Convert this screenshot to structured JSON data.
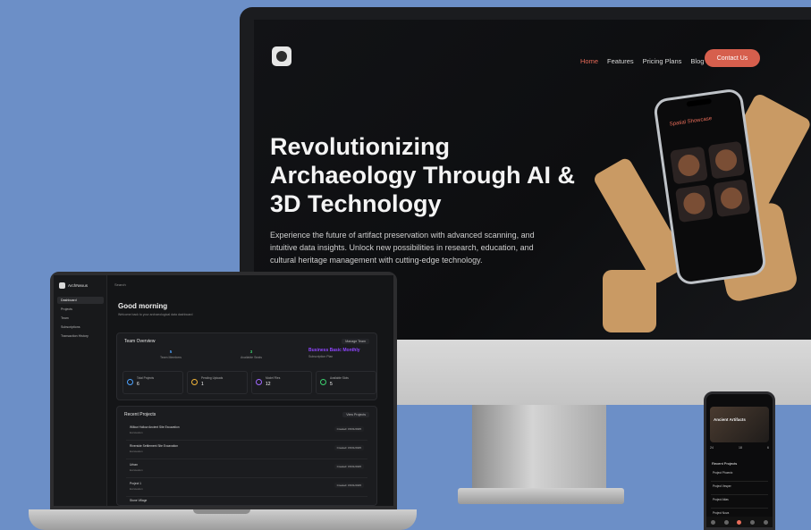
{
  "website": {
    "nav": [
      "Home",
      "Features",
      "Pricing Plans",
      "Blog"
    ],
    "nav_active": 0,
    "contact_label": "Contact Us",
    "hero_title": "Revolutionizing Archaeology Through AI & 3D Technology",
    "hero_subtitle": "Experience the future of artifact preservation with advanced scanning, and intuitive data insights. Unlock new possibilities in research, education, and cultural heritage management with cutting-edge technology.",
    "phone_title": "Spatial Showcase"
  },
  "laptop": {
    "app_name": "ArchNexus",
    "menu": [
      "Dashboard",
      "Projects",
      "Team",
      "Subscriptions",
      "Transaction History"
    ],
    "menu_active": 0,
    "search": "Search",
    "greeting": "Good morning",
    "greeting_sub": "Welcome back to your archaeological data dashboard",
    "team_overview_title": "Team Overview",
    "team_action": "Manage Team",
    "team_stats": [
      {
        "value": "5",
        "label": "Team Members"
      },
      {
        "value": "3",
        "label": "Available Seats"
      }
    ],
    "plan_name": "Business Basic Monthly",
    "plan_label": "Subscription Plan",
    "metrics": [
      {
        "label": "Total Projects",
        "value": "6"
      },
      {
        "label": "Pending Uploads",
        "value": "1"
      },
      {
        "label": "Model Files",
        "value": "12"
      },
      {
        "label": "Available Slots",
        "value": "5"
      }
    ],
    "recent_title": "Recent Projects",
    "recent_action": "View Projects",
    "projects": [
      {
        "name": "Willow Hollow Ancient Site Excavation",
        "sub": "Excavation",
        "date": "Created: 15/01/2025"
      },
      {
        "name": "Riverside Settlement Site Excavation",
        "sub": "Excavation",
        "date": "Created: 15/01/2025"
      },
      {
        "name": "Urban",
        "sub": "Excavation",
        "date": "Created: 15/01/2025"
      },
      {
        "name": "Project 1",
        "sub": "Excavation",
        "date": "Created: 15/01/2025"
      },
      {
        "name": "Stone Village",
        "sub": "Excavation",
        "date": "Created: 15/01/2025"
      }
    ]
  },
  "phone": {
    "hero": "Ancient Artifacts",
    "stats": [
      "24",
      "18",
      "6"
    ],
    "section": "Recent Projects",
    "items": [
      "Project Phoenix",
      "Project Vesper",
      "Project Atlas",
      "Project Nova"
    ]
  },
  "colors": {
    "background": "#6c8fc7",
    "accent": "#d65f4d",
    "plan_purple": "#8f45ff"
  }
}
